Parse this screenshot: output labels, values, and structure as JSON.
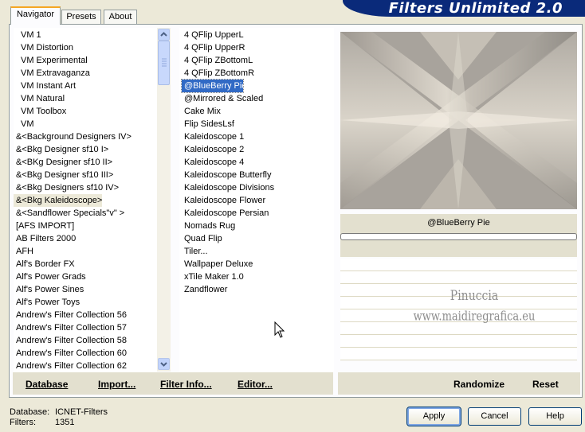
{
  "app": {
    "title": "Filters Unlimited 2.0"
  },
  "tabs": [
    {
      "label": "Navigator",
      "active": true
    },
    {
      "label": "Presets",
      "active": false
    },
    {
      "label": "About",
      "active": false
    }
  ],
  "categories": {
    "selected": "&<Bkg Kaleidoscope>",
    "items": [
      "VM 1",
      "VM Distortion",
      "VM Experimental",
      "VM Extravaganza",
      "VM Instant Art",
      "VM Natural",
      "VM Toolbox",
      "VM",
      "&<Background Designers IV>",
      "&<Bkg Designer sf10 I>",
      "&<BKg Designer sf10 II>",
      "&<Bkg Designer sf10 III>",
      "&<Bkg Designers sf10 IV>",
      "&<Bkg Kaleidoscope>",
      "&<Sandflower Specials\"v\" >",
      "[AFS IMPORT]",
      "AB Filters 2000",
      "AFH",
      "Alf's Border FX",
      "Alf's Power Grads",
      "Alf's Power Sines",
      "Alf's Power Toys",
      "Andrew's Filter Collection 56",
      "Andrew's Filter Collection 57",
      "Andrew's Filter Collection 58",
      "Andrew's Filter Collection 60",
      "Andrew's Filter Collection 62"
    ]
  },
  "filters": {
    "selected": "@BlueBerry Pie",
    "items": [
      "4 QFlip UpperL",
      "4 QFlip UpperR",
      "4 QFlip ZBottomL",
      "4 QFlip ZBottomR",
      "@BlueBerry Pie",
      "@Mirrored & Scaled",
      "Cake Mix",
      "Flip SidesLsf",
      "Kaleidoscope 1",
      "Kaleidoscope 2",
      "Kaleidoscope 4",
      "Kaleidoscope Butterfly",
      "Kaleidoscope Divisions",
      "Kaleidoscope Flower",
      "Kaleidoscope Persian",
      "Nomads Rug",
      "Quad Flip",
      "Tiler...",
      "Wallpaper Deluxe",
      "xTile Maker 1.0",
      "Zandflower"
    ]
  },
  "preview": {
    "filter_name": "@BlueBerry Pie",
    "watermark_line1": "Pinuccia",
    "watermark_line2": "www.maidiregrafica.eu"
  },
  "bottom_buttons": {
    "database": "Database",
    "import": "Import...",
    "filter_info": "Filter Info...",
    "editor": "Editor...",
    "randomize": "Randomize",
    "reset": "Reset"
  },
  "status": {
    "database_label": "Database:",
    "database_value": "ICNET-Filters",
    "filters_label": "Filters:",
    "filters_value": "1351"
  },
  "dialog_buttons": {
    "apply": "Apply",
    "cancel": "Cancel",
    "help": "Help"
  }
}
